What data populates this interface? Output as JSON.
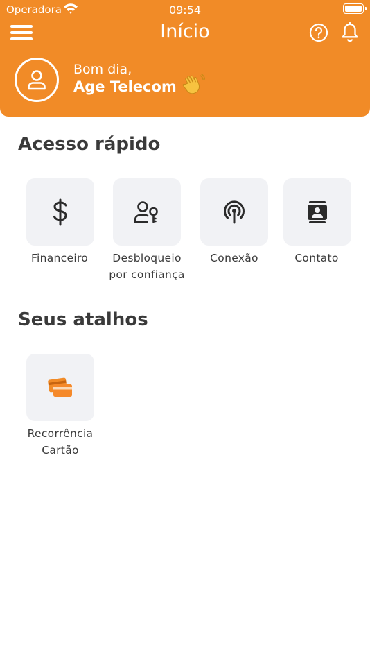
{
  "status_bar": {
    "carrier": "Operadora",
    "time": "09:54"
  },
  "header": {
    "title": "Início",
    "greeting": "Bom dia,",
    "user_name": "Age Telecom",
    "accent_color": "#f18b27"
  },
  "quick_access": {
    "title": "Acesso rápido",
    "items": [
      {
        "label": "Financeiro",
        "icon": "dollar-icon"
      },
      {
        "label_line1": "Desbloqueio",
        "label_line2": "por confiança",
        "icon": "user-key-icon"
      },
      {
        "label": "Conexão",
        "icon": "antenna-icon"
      },
      {
        "label": "Contato",
        "icon": "contact-card-icon"
      }
    ]
  },
  "shortcuts": {
    "title": "Seus atalhos",
    "items": [
      {
        "label_line1": "Recorrência",
        "label_line2": "Cartão",
        "icon": "credit-cards-icon"
      }
    ]
  }
}
